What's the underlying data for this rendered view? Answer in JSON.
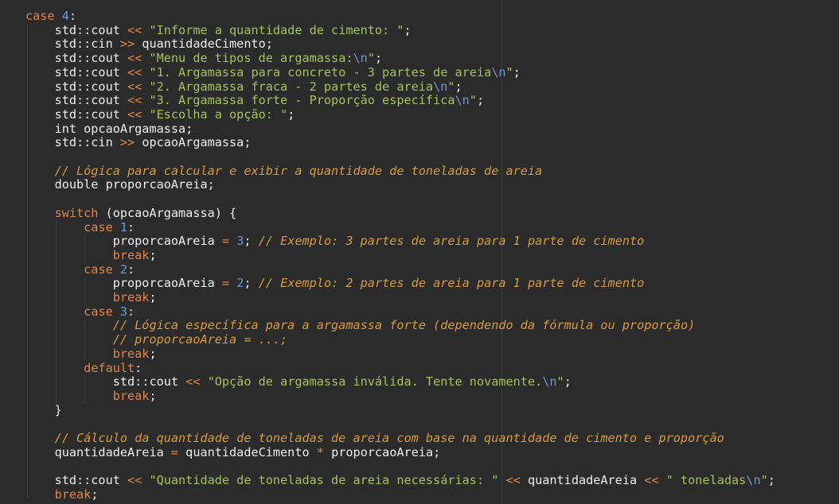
{
  "lines": [
    [
      [
        "kw",
        "case "
      ],
      [
        "num",
        "4"
      ],
      [
        "id",
        ":"
      ]
    ],
    [
      [
        "id",
        "    std::cout "
      ],
      [
        "op",
        "<<"
      ],
      [
        "str",
        " \"Informe a quantidade de cimento: \""
      ],
      [
        "id",
        ";"
      ]
    ],
    [
      [
        "id",
        "    std::cin "
      ],
      [
        "op",
        ">>"
      ],
      [
        "id",
        " quantidadeCimento;"
      ]
    ],
    [
      [
        "id",
        "    std::cout "
      ],
      [
        "op",
        "<<"
      ],
      [
        "str",
        " \"Menu de tipos de argamassa:"
      ],
      [
        "esc",
        "\\n"
      ],
      [
        "str",
        "\""
      ],
      [
        "id",
        ";"
      ]
    ],
    [
      [
        "id",
        "    std::cout "
      ],
      [
        "op",
        "<<"
      ],
      [
        "str",
        " \"1. Argamassa para concreto - 3 partes de areia"
      ],
      [
        "esc",
        "\\n"
      ],
      [
        "str",
        "\""
      ],
      [
        "id",
        ";"
      ]
    ],
    [
      [
        "id",
        "    std::cout "
      ],
      [
        "op",
        "<<"
      ],
      [
        "str",
        " \"2. Argamassa fraca - 2 partes de areia"
      ],
      [
        "esc",
        "\\n"
      ],
      [
        "str",
        "\""
      ],
      [
        "id",
        ";"
      ]
    ],
    [
      [
        "id",
        "    std::cout "
      ],
      [
        "op",
        "<<"
      ],
      [
        "str",
        " \"3. Argamassa forte - Proporção específica"
      ],
      [
        "esc",
        "\\n"
      ],
      [
        "str",
        "\""
      ],
      [
        "id",
        ";"
      ]
    ],
    [
      [
        "id",
        "    std::cout "
      ],
      [
        "op",
        "<<"
      ],
      [
        "str",
        " \"Escolha a opção: \""
      ],
      [
        "id",
        ";"
      ]
    ],
    [
      [
        "id",
        "    int opcaoArgamassa;"
      ]
    ],
    [
      [
        "id",
        "    std::cin "
      ],
      [
        "op",
        ">>"
      ],
      [
        "id",
        " opcaoArgamassa;"
      ]
    ],
    [],
    [
      [
        "id",
        "    "
      ],
      [
        "cm",
        "// Lógica para calcular e exibir a quantidade de toneladas de areia"
      ]
    ],
    [
      [
        "id",
        "    double proporcaoAreia;"
      ]
    ],
    [],
    [
      [
        "id",
        "    "
      ],
      [
        "kw",
        "switch"
      ],
      [
        "id",
        " (opcaoArgamassa) {"
      ]
    ],
    [
      [
        "id",
        "        "
      ],
      [
        "kw",
        "case "
      ],
      [
        "num",
        "1"
      ],
      [
        "id",
        ":"
      ]
    ],
    [
      [
        "id",
        "            proporcaoAreia "
      ],
      [
        "op",
        "="
      ],
      [
        "id",
        " "
      ],
      [
        "num",
        "3"
      ],
      [
        "id",
        "; "
      ],
      [
        "cm",
        "// Exemplo: 3 partes de areia para 1 parte de cimento"
      ]
    ],
    [
      [
        "id",
        "            "
      ],
      [
        "kw",
        "break"
      ],
      [
        "id",
        ";"
      ]
    ],
    [
      [
        "id",
        "        "
      ],
      [
        "kw",
        "case "
      ],
      [
        "num",
        "2"
      ],
      [
        "id",
        ":"
      ]
    ],
    [
      [
        "id",
        "            proporcaoAreia "
      ],
      [
        "op",
        "="
      ],
      [
        "id",
        " "
      ],
      [
        "num",
        "2"
      ],
      [
        "id",
        "; "
      ],
      [
        "cm",
        "// Exemplo: 2 partes de areia para 1 parte de cimento"
      ]
    ],
    [
      [
        "id",
        "            "
      ],
      [
        "kw",
        "break"
      ],
      [
        "id",
        ";"
      ]
    ],
    [
      [
        "id",
        "        "
      ],
      [
        "kw",
        "case "
      ],
      [
        "num",
        "3"
      ],
      [
        "id",
        ":"
      ]
    ],
    [
      [
        "id",
        "            "
      ],
      [
        "cm",
        "// Lógica específica para a argamassa forte (dependendo da fórmula ou proporção)"
      ]
    ],
    [
      [
        "id",
        "            "
      ],
      [
        "cm",
        "// proporcaoAreia = ...;"
      ]
    ],
    [
      [
        "id",
        "            "
      ],
      [
        "kw",
        "break"
      ],
      [
        "id",
        ";"
      ]
    ],
    [
      [
        "id",
        "        "
      ],
      [
        "kw",
        "default"
      ],
      [
        "id",
        ":"
      ]
    ],
    [
      [
        "id",
        "            std::cout "
      ],
      [
        "op",
        "<<"
      ],
      [
        "str",
        " \"Opção de argamassa inválida. Tente novamente."
      ],
      [
        "esc",
        "\\n"
      ],
      [
        "str",
        "\""
      ],
      [
        "id",
        ";"
      ]
    ],
    [
      [
        "id",
        "            "
      ],
      [
        "kw",
        "break"
      ],
      [
        "id",
        ";"
      ]
    ],
    [
      [
        "id",
        "    }"
      ]
    ],
    [],
    [
      [
        "id",
        "    "
      ],
      [
        "cm",
        "// Cálculo da quantidade de toneladas de areia com base na quantidade de cimento e proporção"
      ]
    ],
    [
      [
        "id",
        "    quantidadeAreia "
      ],
      [
        "op",
        "="
      ],
      [
        "id",
        " quantidadeCimento "
      ],
      [
        "op",
        "*"
      ],
      [
        "id",
        " proporcaoAreia;"
      ]
    ],
    [],
    [
      [
        "id",
        "    std::cout "
      ],
      [
        "op",
        "<<"
      ],
      [
        "str",
        " \"Quantidade de toneladas de areia necessárias: \""
      ],
      [
        "id",
        " "
      ],
      [
        "op",
        "<<"
      ],
      [
        "id",
        " quantidadeAreia "
      ],
      [
        "op",
        "<<"
      ],
      [
        "str",
        " \" toneladas"
      ],
      [
        "esc",
        "\\n"
      ],
      [
        "str",
        "\""
      ],
      [
        "id",
        ";"
      ]
    ],
    [
      [
        "id",
        "    "
      ],
      [
        "kw",
        "break"
      ],
      [
        "id",
        ";"
      ]
    ]
  ]
}
